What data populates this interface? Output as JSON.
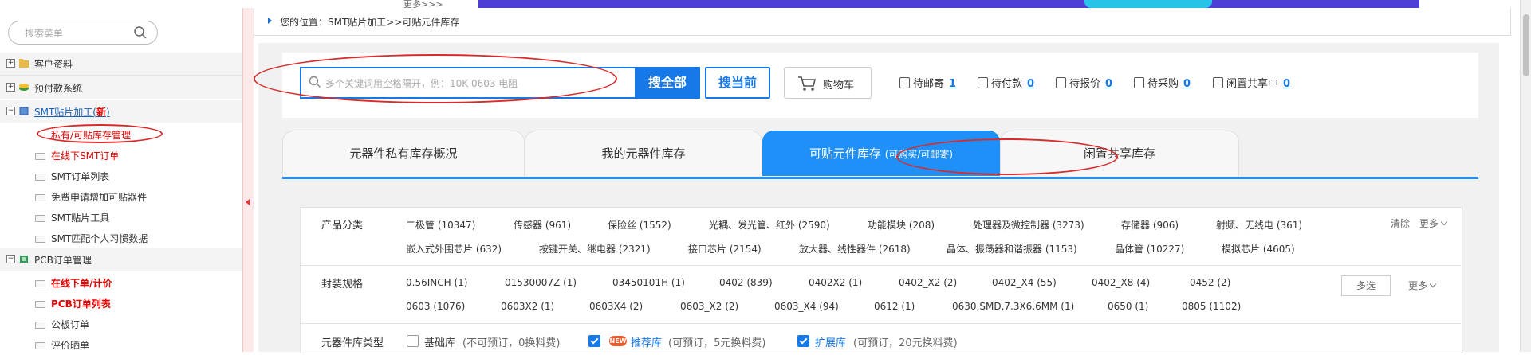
{
  "banner": {
    "more_text": "更多>>>"
  },
  "sidebar": {
    "search_placeholder": "搜索菜单",
    "groups": [
      {
        "label": "客户资料"
      },
      {
        "label": "预付款系统"
      },
      {
        "label": "SMT贴片加工(",
        "badge": "新",
        "suffix": ")"
      },
      {
        "label": "PCB订单管理"
      }
    ],
    "smt_items": [
      {
        "label": "私有/可贴库存管理"
      },
      {
        "label": "在线下SMT订单"
      },
      {
        "label": "SMT订单列表"
      },
      {
        "label": "免费申请增加可贴器件"
      },
      {
        "label": "SMT贴片工具"
      },
      {
        "label": "SMT匹配个人习惯数据"
      }
    ],
    "pcb_items": [
      {
        "label": "在线下单/计价"
      },
      {
        "label": "PCB订单列表"
      },
      {
        "label": "公板订单"
      },
      {
        "label": "评价晒单"
      }
    ]
  },
  "breadcrumb": {
    "text": "您的位置：SMT贴片加工>>可贴元件库存"
  },
  "search": {
    "placeholder": "多个关键词用空格隔开，例：10K 0603 电阻",
    "search_all_label": "搜全部",
    "search_current_label": "搜当前",
    "cart_label": "购物车"
  },
  "status": [
    {
      "label": "待邮寄",
      "count": "1"
    },
    {
      "label": "待付款",
      "count": "0"
    },
    {
      "label": "待报价",
      "count": "0"
    },
    {
      "label": "待采购",
      "count": "0"
    },
    {
      "label": "闲置共享中",
      "count": "0"
    }
  ],
  "tabs": [
    {
      "label": "元器件私有库存概况"
    },
    {
      "label": "我的元器件库存"
    },
    {
      "label": "可贴元件库存",
      "note": "(可购买/可邮寄)"
    },
    {
      "label": "闲置共享库存"
    }
  ],
  "filters": {
    "category_label": "产品分类",
    "category_items": [
      "二极管 (10347)",
      "传感器 (961)",
      "保险丝 (1552)",
      "光耦、发光管、红外 (2590)",
      "功能模块 (208)",
      "处理器及微控制器 (3273)",
      "存储器 (906)",
      "射频、无线电 (361)",
      "嵌入式外围芯片 (632)",
      "按键开关、继电器 (2321)",
      "接口芯片 (2154)",
      "放大器、线性器件 (2618)",
      "晶体、振荡器和谐振器 (1153)",
      "晶体管 (10227)",
      "模拟芯片 (4605)"
    ],
    "clear_label": "清除",
    "more_label": "更多",
    "package_label": "封装规格",
    "package_items": [
      "0.56INCH (1)",
      "01530007Z (1)",
      "03450101H (1)",
      "0402 (839)",
      "0402X2 (1)",
      "0402_X2 (2)",
      "0402_X4 (55)",
      "0402_X8 (4)",
      "0452 (2)",
      "0603 (1076)",
      "0603X2 (1)",
      "0603X4 (2)",
      "0603_X2 (2)",
      "0603_X4 (94)",
      "0612 (1)",
      "0630,SMD,7.3X6.6MM (1)",
      "0650 (1)",
      "0805 (1102)"
    ],
    "multi_label": "多选",
    "stock_type_label": "元器件库类型",
    "stock_types": [
      {
        "name": "基础库",
        "note": "(不可预订，0换料费)",
        "checked": false
      },
      {
        "name": "推荐库",
        "note": "(可预订，5元换料费)",
        "checked": true,
        "badge": "NEW"
      },
      {
        "name": "扩展库",
        "note": "(可预订，20元换料费)",
        "checked": true
      }
    ]
  },
  "colors": {
    "accent": "#1778e8",
    "annotation": "#d92b2b",
    "badge": "#f05a2a"
  }
}
